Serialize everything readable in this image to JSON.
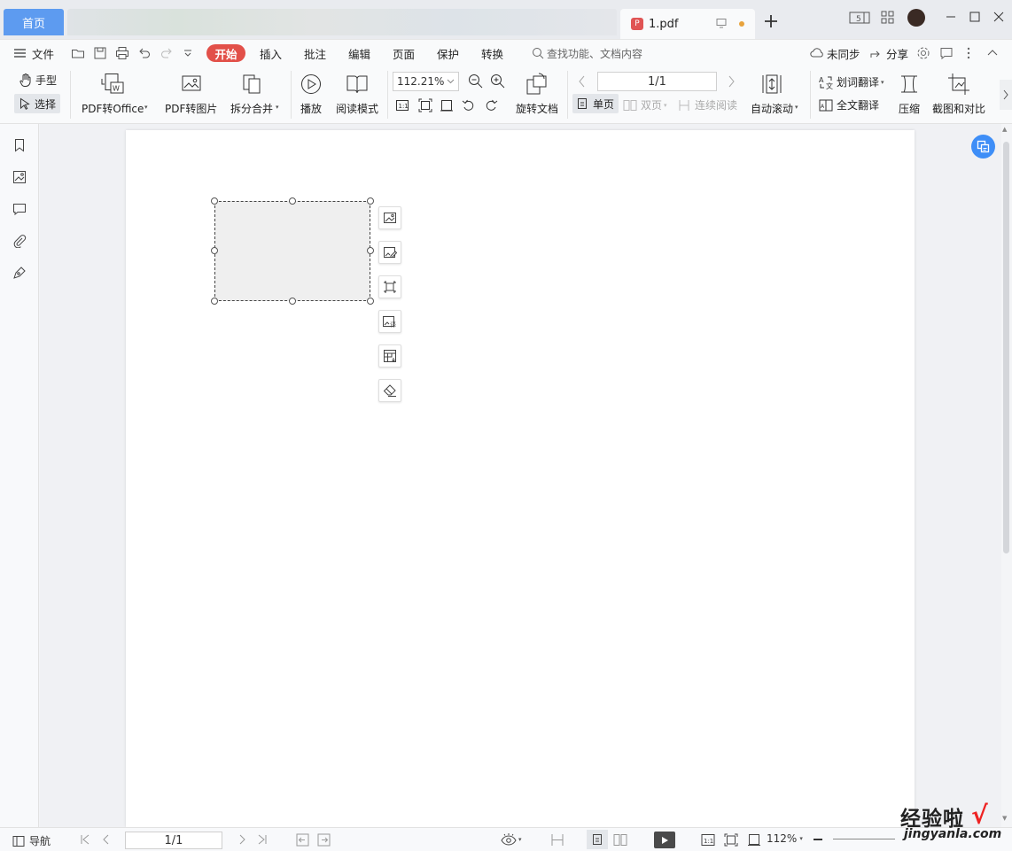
{
  "tabs": {
    "home": "首页",
    "document": "1.pdf"
  },
  "menu": {
    "file": "文件",
    "items": [
      "开始",
      "插入",
      "批注",
      "编辑",
      "页面",
      "保护",
      "转换"
    ],
    "search_placeholder": "查找功能、文档内容",
    "sync": "未同步",
    "share": "分享"
  },
  "ribbon": {
    "hand": "手型",
    "select": "选择",
    "pdf_to_office": "PDF转Office",
    "pdf_to_image": "PDF转图片",
    "split_merge": "拆分合并",
    "play": "播放",
    "read_mode": "阅读模式",
    "zoom": "112.21%",
    "rotate_doc": "旋转文档",
    "page_indicator": "1/1",
    "single_page": "单页",
    "double_page": "双页",
    "continuous": "连续阅读",
    "auto_scroll": "自动滚动",
    "word_translate": "划词翻译",
    "full_translate": "全文翻译",
    "compress": "压缩",
    "screenshot_compare": "截图和对比"
  },
  "status": {
    "nav": "导航",
    "page": "1/1",
    "zoom": "112%"
  },
  "watermark": {
    "text": "经验啦",
    "url": "jingyanla.com"
  },
  "colors": {
    "accent": "#5d9bf0",
    "start_pill": "#e25049",
    "fab": "#3e8ef7"
  }
}
